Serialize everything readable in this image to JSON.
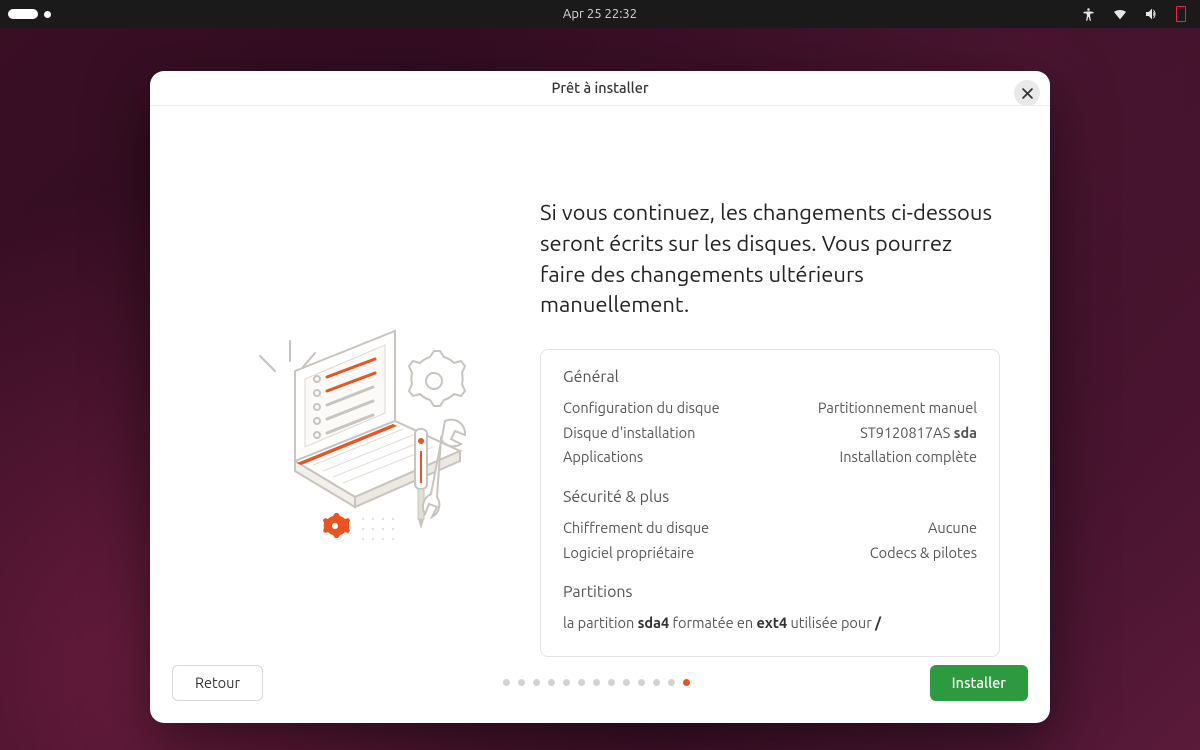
{
  "topbar": {
    "datetime": "Apr 25  22:32"
  },
  "window": {
    "title": "Prêt à installer"
  },
  "headline": "Si vous continuez, les changements ci-dessous seront écrits sur les disques. Vous pourrez faire des changements ultérieurs manuellement.",
  "summary": {
    "general": {
      "title": "Général",
      "disk_config_label": "Configuration du disque",
      "disk_config_value": "Partitionnement manuel",
      "install_disk_label": "Disque d'installation",
      "install_disk_value_prefix": "ST9120817AS ",
      "install_disk_value_bold": "sda",
      "applications_label": "Applications",
      "applications_value": "Installation complète"
    },
    "security": {
      "title": "Sécurité & plus",
      "encryption_label": "Chiffrement du disque",
      "encryption_value": "Aucune",
      "proprietary_label": "Logiciel propriétaire",
      "proprietary_value": "Codecs & pilotes"
    },
    "partitions": {
      "title": "Partitions",
      "line_a": "la partition ",
      "line_b": "sda4",
      "line_c": " formatée en ",
      "line_d": "ext4",
      "line_e": " utilisée pour ",
      "line_f": "/"
    }
  },
  "footer": {
    "back": "Retour",
    "install": "Installer",
    "total_steps": 13,
    "active_step": 13
  }
}
